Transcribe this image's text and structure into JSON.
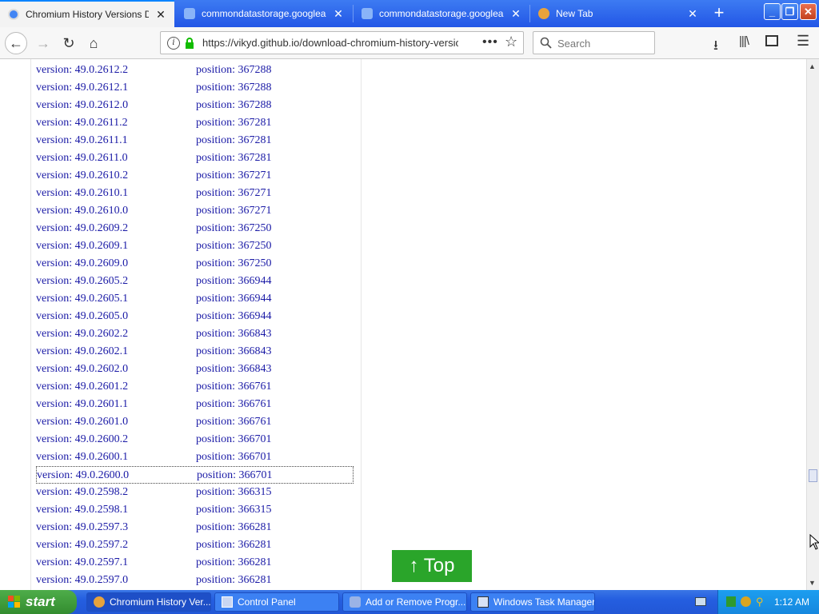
{
  "tabs": [
    {
      "label": "Chromium History Versions Download",
      "active": true,
      "favicon_color": "#4285f4"
    },
    {
      "label": "commondatastorage.googleapis.com",
      "active": false,
      "favicon_color": "#8ab4f8"
    },
    {
      "label": "commondatastorage.googleapis.com",
      "active": false,
      "favicon_color": "#8ab4f8"
    },
    {
      "label": "New Tab",
      "active": false,
      "favicon_color": "#e8a33d"
    }
  ],
  "toolbar": {
    "url": "https://vikyd.github.io/download-chromium-history-version",
    "search_placeholder": "Search"
  },
  "rows": [
    {
      "version": "version: 49.0.2612.2",
      "position": "position: 367288"
    },
    {
      "version": "version: 49.0.2612.1",
      "position": "position: 367288"
    },
    {
      "version": "version: 49.0.2612.0",
      "position": "position: 367288"
    },
    {
      "version": "version: 49.0.2611.2",
      "position": "position: 367281"
    },
    {
      "version": "version: 49.0.2611.1",
      "position": "position: 367281"
    },
    {
      "version": "version: 49.0.2611.0",
      "position": "position: 367281"
    },
    {
      "version": "version: 49.0.2610.2",
      "position": "position: 367271"
    },
    {
      "version": "version: 49.0.2610.1",
      "position": "position: 367271"
    },
    {
      "version": "version: 49.0.2610.0",
      "position": "position: 367271"
    },
    {
      "version": "version: 49.0.2609.2",
      "position": "position: 367250"
    },
    {
      "version": "version: 49.0.2609.1",
      "position": "position: 367250"
    },
    {
      "version": "version: 49.0.2609.0",
      "position": "position: 367250"
    },
    {
      "version": "version: 49.0.2605.2",
      "position": "position: 366944"
    },
    {
      "version": "version: 49.0.2605.1",
      "position": "position: 366944"
    },
    {
      "version": "version: 49.0.2605.0",
      "position": "position: 366944"
    },
    {
      "version": "version: 49.0.2602.2",
      "position": "position: 366843"
    },
    {
      "version": "version: 49.0.2602.1",
      "position": "position: 366843"
    },
    {
      "version": "version: 49.0.2602.0",
      "position": "position: 366843"
    },
    {
      "version": "version: 49.0.2601.2",
      "position": "position: 366761"
    },
    {
      "version": "version: 49.0.2601.1",
      "position": "position: 366761"
    },
    {
      "version": "version: 49.0.2601.0",
      "position": "position: 366761"
    },
    {
      "version": "version: 49.0.2600.2",
      "position": "position: 366701"
    },
    {
      "version": "version: 49.0.2600.1",
      "position": "position: 366701"
    },
    {
      "version": "version: 49.0.2600.0",
      "position": "position: 366701",
      "focused": true
    },
    {
      "version": "version: 49.0.2598.2",
      "position": "position: 366315"
    },
    {
      "version": "version: 49.0.2598.1",
      "position": "position: 366315"
    },
    {
      "version": "version: 49.0.2597.3",
      "position": "position: 366281"
    },
    {
      "version": "version: 49.0.2597.2",
      "position": "position: 366281"
    },
    {
      "version": "version: 49.0.2597.1",
      "position": "position: 366281"
    },
    {
      "version": "version: 49.0.2597.0",
      "position": "position: 366281"
    }
  ],
  "top_button": {
    "label": "↑ Top"
  },
  "taskbar": {
    "start_label": "start",
    "tasks": [
      {
        "label": "Chromium History Ver...",
        "active": true
      },
      {
        "label": "Control Panel",
        "active": false
      },
      {
        "label": "Add or Remove Progr...",
        "active": false
      },
      {
        "label": "Windows Task Manager",
        "active": false
      }
    ],
    "clock": "1:12 AM"
  },
  "colors": {
    "accent": "#0a84ff",
    "link": "#1a1aa6",
    "top_button": "#2aa52a"
  }
}
